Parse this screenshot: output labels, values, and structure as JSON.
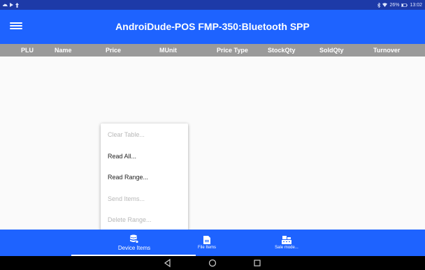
{
  "status_bar": {
    "battery": "26%",
    "time": "13:02"
  },
  "app_bar": {
    "title": "AndroiDude-POS   FMP-350:Bluetooth SPP"
  },
  "table": {
    "columns": [
      "PLU",
      "Name",
      "Price",
      "MUnit",
      "Price Type",
      "StockQty",
      "SoldQty",
      "Turnover"
    ]
  },
  "popup_menu": {
    "items": [
      {
        "label": "Clear Table...",
        "enabled": false
      },
      {
        "label": "Read All...",
        "enabled": true
      },
      {
        "label": "Read Range...",
        "enabled": true
      },
      {
        "label": "Send Items...",
        "enabled": false
      },
      {
        "label": "Delete Range...",
        "enabled": false
      }
    ]
  },
  "bottom_tabs": [
    {
      "label": "Device Items",
      "icon": "database-icon",
      "active": true
    },
    {
      "label": "File Items",
      "icon": "file-icon",
      "active": false
    },
    {
      "label": "Sale mode...",
      "icon": "register-icon",
      "active": false
    }
  ],
  "nav_bar": {
    "buttons": [
      "back-icon",
      "home-icon",
      "recents-icon"
    ]
  },
  "colors": {
    "status_bar": "#1d3aa8",
    "accent": "#1e63ff",
    "table_header": "#9a9a9a",
    "nav_bar": "#000000"
  }
}
